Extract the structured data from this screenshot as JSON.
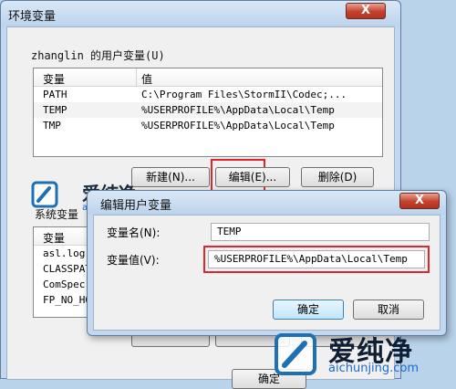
{
  "env_window": {
    "title": "环境变量",
    "close_label": "X",
    "user_group_label": "zhanglin 的用户变量(U)",
    "user_table": {
      "headers": [
        "变量",
        "值"
      ],
      "rows": [
        {
          "name": "PATH",
          "value": "C:\\Program Files\\StormII\\Codec;..."
        },
        {
          "name": "TEMP",
          "value": "%USERPROFILE%\\AppData\\Local\\Temp"
        },
        {
          "name": "TMP",
          "value": "%USERPROFILE%\\AppData\\Local\\Temp"
        }
      ]
    },
    "user_buttons": {
      "new": "新建(N)...",
      "edit": "编辑(E)...",
      "delete": "删除(D)"
    },
    "system_group_label": "系统变量",
    "system_table": {
      "headers": [
        "变量"
      ],
      "rows": [
        {
          "name": "asl.log"
        },
        {
          "name": "CLASSPATH"
        },
        {
          "name": "ComSpec"
        },
        {
          "name": "FP_NO_HOST"
        }
      ]
    },
    "ok_label": "确定"
  },
  "edit_dialog": {
    "title": "编辑用户变量",
    "close_label": "X",
    "name_label": "变量名(N):",
    "name_value": "TEMP",
    "value_label": "变量值(V):",
    "value_value": "%USERPROFILE%\\AppData\\Local\\Temp",
    "ok_label": "确定",
    "cancel_label": "取消"
  },
  "watermark": {
    "brand": "爱纯净",
    "url": "aichunjing.com"
  },
  "colors": {
    "highlight_box": "#e0262c",
    "close_button": "#c4412d",
    "window_frame": "#c3d8ee"
  }
}
